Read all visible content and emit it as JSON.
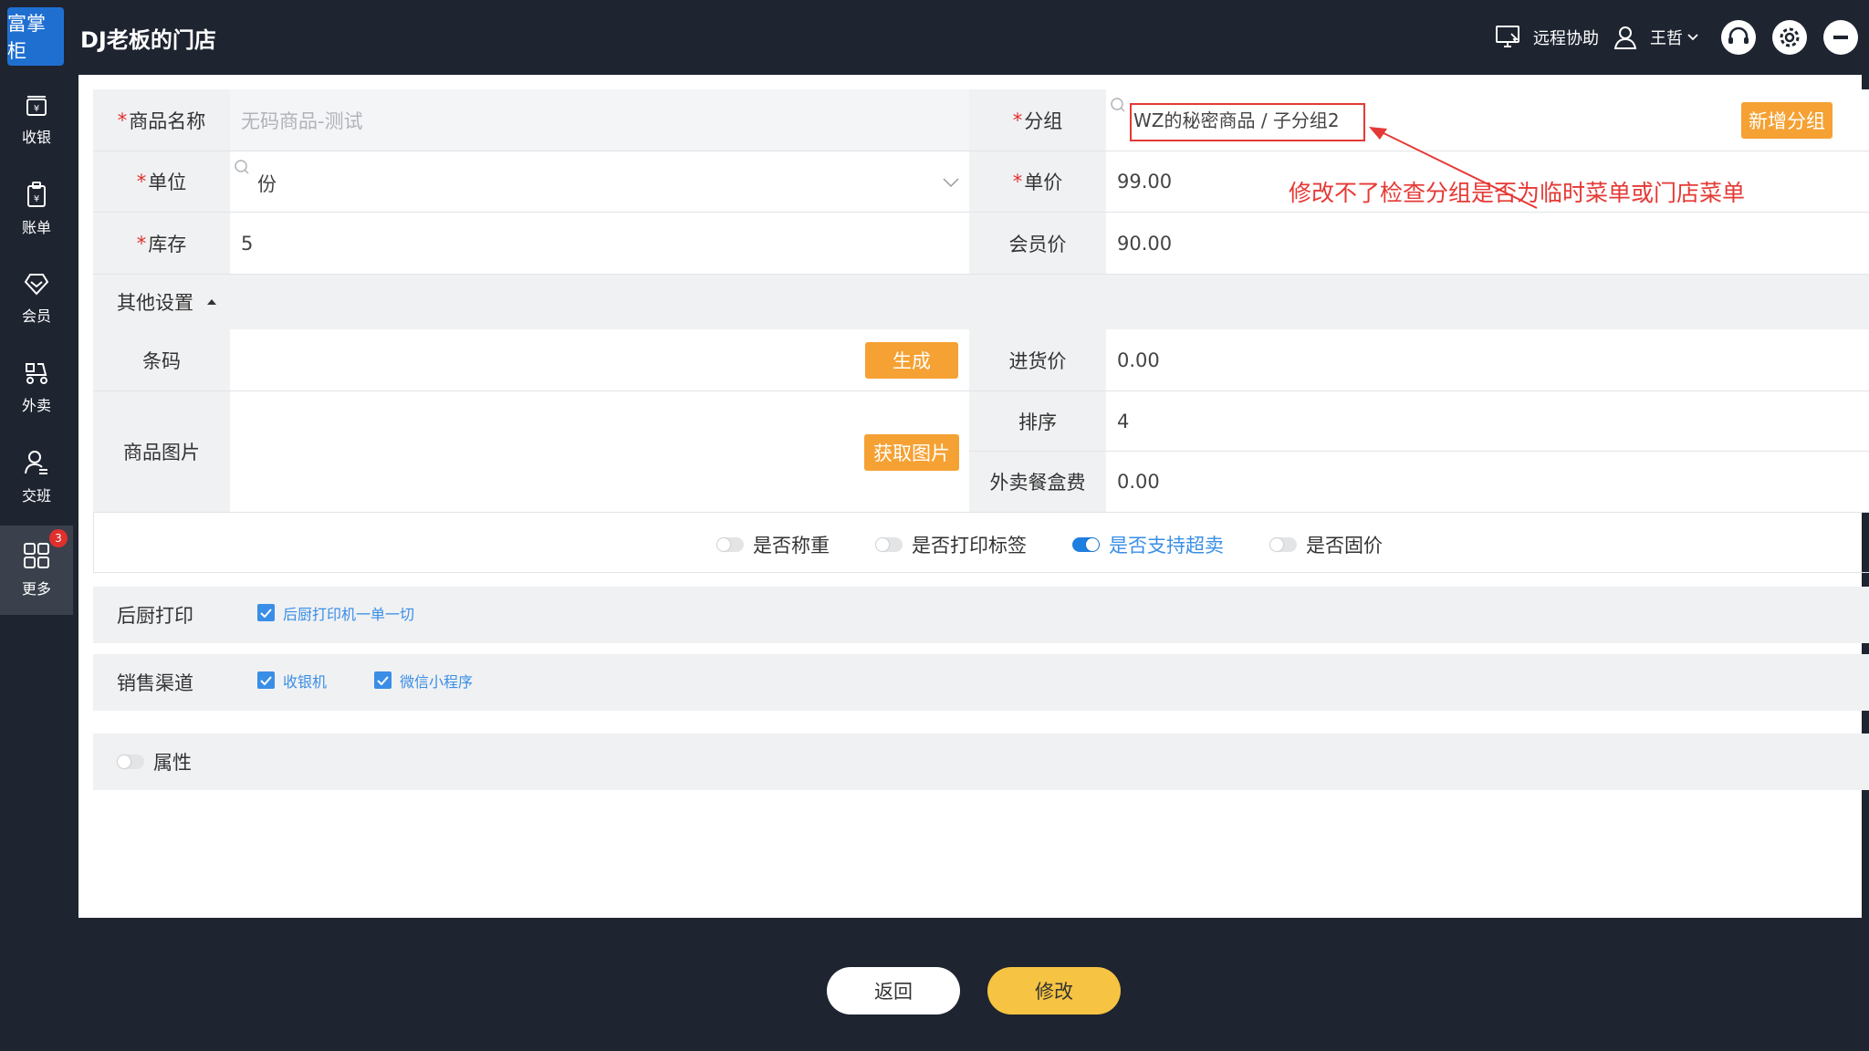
{
  "app": {
    "logo_text": "富掌柜",
    "store_title": "DJ老板的门店"
  },
  "topbar": {
    "remote_label": "远程协助",
    "user_name": "王哲"
  },
  "sidebar": {
    "items": [
      {
        "label": "收银",
        "icon": "cash-register-icon"
      },
      {
        "label": "账单",
        "icon": "bill-icon"
      },
      {
        "label": "会员",
        "icon": "member-icon"
      },
      {
        "label": "外卖",
        "icon": "delivery-icon"
      },
      {
        "label": "交班",
        "icon": "shift-icon"
      },
      {
        "label": "更多",
        "icon": "grid-icon",
        "badge": "3"
      }
    ]
  },
  "form": {
    "required_mark": "*",
    "name_label": "商品名称",
    "name_placeholder": "无码商品-测试",
    "group_label": "分组",
    "group_value": "WZ的秘密商品 / 子分组2",
    "add_group_button": "新增分组",
    "unit_label": "单位",
    "unit_value": "份",
    "price_label": "单价",
    "price_value": "99.00",
    "stock_label": "库存",
    "stock_value": "5",
    "member_price_label": "会员价",
    "member_price_value": "90.00",
    "other_settings_label": "其他设置",
    "barcode_label": "条码",
    "barcode_value": "",
    "generate_button": "生成",
    "purchase_price_label": "进货价",
    "purchase_price_value": "0.00",
    "image_label": "商品图片",
    "get_image_button": "获取图片",
    "sort_label": "排序",
    "sort_value": "4",
    "box_fee_label": "外卖餐盒费",
    "box_fee_value": "0.00"
  },
  "toggles": [
    {
      "label": "是否称重",
      "on": false
    },
    {
      "label": "是否打印标签",
      "on": false
    },
    {
      "label": "是否支持超卖",
      "on": true
    },
    {
      "label": "是否固价",
      "on": false
    }
  ],
  "kitchen_print": {
    "label": "后厨打印",
    "option": "后厨打印机一单一切",
    "checked": true
  },
  "sales_channel": {
    "label": "销售渠道",
    "options": [
      {
        "label": "收银机",
        "checked": true
      },
      {
        "label": "微信小程序",
        "checked": true
      }
    ]
  },
  "attributes": {
    "label": "属性",
    "on": false
  },
  "annotation": {
    "text": "修改不了检查分组是否为临时菜单或门店菜单",
    "color": "#e53935"
  },
  "actions": {
    "back": "返回",
    "modify": "修改"
  },
  "colors": {
    "accent_orange": "#f5a133",
    "modify_yellow": "#f6c342",
    "link_blue": "#3a8ee6",
    "sidebar_bg": "#1e2430"
  }
}
